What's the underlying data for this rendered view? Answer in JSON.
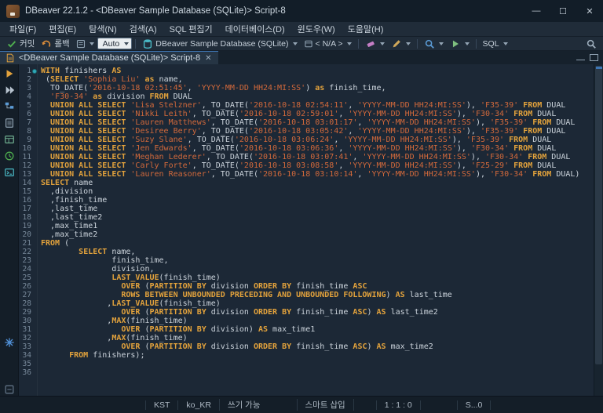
{
  "window": {
    "title": "DBeaver 22.1.2 - <DBeaver Sample Database (SQLite)> Script-8",
    "controls": {
      "minimize": "—",
      "maximize": "☐",
      "close": "✕"
    }
  },
  "menu": {
    "items": [
      "파일(F)",
      "편집(E)",
      "탐색(N)",
      "검색(A)",
      "SQL 편집기",
      "데이터베이스(D)",
      "윈도우(W)",
      "도움말(H)"
    ]
  },
  "toolbar": {
    "commit_label": "커밋",
    "rollback_label": "롤백",
    "tx_mode": "Auto",
    "connection": "DBeaver Sample Database (SQLite)",
    "schema": "< N/A >",
    "sql_label": "SQL"
  },
  "editor_tab": {
    "label": "<DBeaver Sample Database (SQLite)> Script-8",
    "close_glyph": "✕"
  },
  "statusbar": {
    "segments": [
      "KST",
      "ko_KR",
      "쓰기 가능",
      "스마트 삽입",
      "1 : 1 : 0",
      "S...0"
    ]
  },
  "colors": {
    "keyword": "#e2a23c",
    "string": "#d2693b",
    "plain_text": "#ccd4dc",
    "editor_bg": "#1c2836",
    "accent_blue": "#3e76b4",
    "marker_teal": "#2fa8b8"
  },
  "code": {
    "lines": [
      {
        "n": 1,
        "marker": true,
        "segs": [
          [
            "k",
            "WITH"
          ],
          [
            "p",
            " finishers "
          ],
          [
            "k",
            "AS"
          ]
        ]
      },
      {
        "n": 2,
        "segs": [
          [
            "p",
            " ("
          ],
          [
            "k",
            "SELECT"
          ],
          [
            "p",
            " "
          ],
          [
            "s",
            "'Sophia Liu'"
          ],
          [
            "p",
            " "
          ],
          [
            "k",
            "as"
          ],
          [
            "p",
            " name,"
          ]
        ]
      },
      {
        "n": 3,
        "segs": [
          [
            "p",
            "  TO_DATE("
          ],
          [
            "s",
            "'2016-10-18 02:51:45'"
          ],
          [
            "p",
            ", "
          ],
          [
            "s",
            "'YYYY-MM-DD HH24:MI:SS'"
          ],
          [
            "p",
            ") "
          ],
          [
            "k",
            "as"
          ],
          [
            "p",
            " finish_time,"
          ]
        ]
      },
      {
        "n": 4,
        "segs": [
          [
            "p",
            "  "
          ],
          [
            "s",
            "'F30-34'"
          ],
          [
            "p",
            " "
          ],
          [
            "k",
            "as"
          ],
          [
            "p",
            " division "
          ],
          [
            "k",
            "FROM"
          ],
          [
            "p",
            " DUAL"
          ]
        ]
      },
      {
        "n": 5,
        "segs": [
          [
            "p",
            "  "
          ],
          [
            "k",
            "UNION ALL SELECT"
          ],
          [
            "p",
            " "
          ],
          [
            "s",
            "'Lisa Stelzner'"
          ],
          [
            "p",
            ", TO_DATE("
          ],
          [
            "s",
            "'2016-10-18 02:54:11'"
          ],
          [
            "p",
            ", "
          ],
          [
            "s",
            "'YYYY-MM-DD HH24:MI:SS'"
          ],
          [
            "p",
            "), "
          ],
          [
            "s",
            "'F35-39'"
          ],
          [
            "p",
            " "
          ],
          [
            "k",
            "FROM"
          ],
          [
            "p",
            " DUAL"
          ]
        ]
      },
      {
        "n": 6,
        "segs": [
          [
            "p",
            "  "
          ],
          [
            "k",
            "UNION ALL SELECT"
          ],
          [
            "p",
            " "
          ],
          [
            "s",
            "'Nikki Leith'"
          ],
          [
            "p",
            ", TO_DATE("
          ],
          [
            "s",
            "'2016-10-18 02:59:01'"
          ],
          [
            "p",
            ", "
          ],
          [
            "s",
            "'YYYY-MM-DD HH24:MI:SS'"
          ],
          [
            "p",
            "), "
          ],
          [
            "s",
            "'F30-34'"
          ],
          [
            "p",
            " "
          ],
          [
            "k",
            "FROM"
          ],
          [
            "p",
            " DUAL"
          ]
        ]
      },
      {
        "n": 7,
        "segs": [
          [
            "p",
            "  "
          ],
          [
            "k",
            "UNION ALL SELECT"
          ],
          [
            "p",
            " "
          ],
          [
            "s",
            "'Lauren Matthews'"
          ],
          [
            "p",
            ", TO_DATE("
          ],
          [
            "s",
            "'2016-10-18 03:01:17'"
          ],
          [
            "p",
            ", "
          ],
          [
            "s",
            "'YYYY-MM-DD HH24:MI:SS'"
          ],
          [
            "p",
            "), "
          ],
          [
            "s",
            "'F35-39'"
          ],
          [
            "p",
            " "
          ],
          [
            "k",
            "FROM"
          ],
          [
            "p",
            " DUAL"
          ]
        ]
      },
      {
        "n": 8,
        "segs": [
          [
            "p",
            "  "
          ],
          [
            "k",
            "UNION ALL SELECT"
          ],
          [
            "p",
            " "
          ],
          [
            "s",
            "'Desiree Berry'"
          ],
          [
            "p",
            ", TO_DATE("
          ],
          [
            "s",
            "'2016-10-18 03:05:42'"
          ],
          [
            "p",
            ", "
          ],
          [
            "s",
            "'YYYY-MM-DD HH24:MI:SS'"
          ],
          [
            "p",
            "), "
          ],
          [
            "s",
            "'F35-39'"
          ],
          [
            "p",
            " "
          ],
          [
            "k",
            "FROM"
          ],
          [
            "p",
            " DUAL"
          ]
        ]
      },
      {
        "n": 9,
        "segs": [
          [
            "p",
            "  "
          ],
          [
            "k",
            "UNION ALL SELECT"
          ],
          [
            "p",
            " "
          ],
          [
            "s",
            "'Suzy Slane'"
          ],
          [
            "p",
            ", TO_DATE("
          ],
          [
            "s",
            "'2016-10-18 03:06:24'"
          ],
          [
            "p",
            ", "
          ],
          [
            "s",
            "'YYYY-MM-DD HH24:MI:SS'"
          ],
          [
            "p",
            "), "
          ],
          [
            "s",
            "'F35-39'"
          ],
          [
            "p",
            " "
          ],
          [
            "k",
            "FROM"
          ],
          [
            "p",
            " DUAL"
          ]
        ]
      },
      {
        "n": 10,
        "segs": [
          [
            "p",
            "  "
          ],
          [
            "k",
            "UNION ALL SELECT"
          ],
          [
            "p",
            " "
          ],
          [
            "s",
            "'Jen Edwards'"
          ],
          [
            "p",
            ", TO_DATE("
          ],
          [
            "s",
            "'2016-10-18 03:06:36'"
          ],
          [
            "p",
            ", "
          ],
          [
            "s",
            "'YYYY-MM-DD HH24:MI:SS'"
          ],
          [
            "p",
            "), "
          ],
          [
            "s",
            "'F30-34'"
          ],
          [
            "p",
            " "
          ],
          [
            "k",
            "FROM"
          ],
          [
            "p",
            " DUAL"
          ]
        ]
      },
      {
        "n": 11,
        "segs": [
          [
            "p",
            "  "
          ],
          [
            "k",
            "UNION ALL SELECT"
          ],
          [
            "p",
            " "
          ],
          [
            "s",
            "'Meghan Lederer'"
          ],
          [
            "p",
            ", TO_DATE("
          ],
          [
            "s",
            "'2016-10-18 03:07:41'"
          ],
          [
            "p",
            ", "
          ],
          [
            "s",
            "'YYYY-MM-DD HH24:MI:SS'"
          ],
          [
            "p",
            "), "
          ],
          [
            "s",
            "'F30-34'"
          ],
          [
            "p",
            " "
          ],
          [
            "k",
            "FROM"
          ],
          [
            "p",
            " DUAL"
          ]
        ]
      },
      {
        "n": 12,
        "segs": [
          [
            "p",
            "  "
          ],
          [
            "k",
            "UNION ALL SELECT"
          ],
          [
            "p",
            " "
          ],
          [
            "s",
            "'Carly Forte'"
          ],
          [
            "p",
            ", TO_DATE("
          ],
          [
            "s",
            "'2016-10-18 03:08:58'"
          ],
          [
            "p",
            ", "
          ],
          [
            "s",
            "'YYYY-MM-DD HH24:MI:SS'"
          ],
          [
            "p",
            "), "
          ],
          [
            "s",
            "'F25-29'"
          ],
          [
            "p",
            " "
          ],
          [
            "k",
            "FROM"
          ],
          [
            "p",
            " DUAL"
          ]
        ]
      },
      {
        "n": 13,
        "segs": [
          [
            "p",
            "  "
          ],
          [
            "k",
            "UNION ALL SELECT"
          ],
          [
            "p",
            " "
          ],
          [
            "s",
            "'Lauren Reasoner'"
          ],
          [
            "p",
            ", TO_DATE("
          ],
          [
            "s",
            "'2016-10-18 03:10:14'"
          ],
          [
            "p",
            ", "
          ],
          [
            "s",
            "'YYYY-MM-DD HH24:MI:SS'"
          ],
          [
            "p",
            "), "
          ],
          [
            "s",
            "'F30-34'"
          ],
          [
            "p",
            " "
          ],
          [
            "k",
            "FROM"
          ],
          [
            "p",
            " DUAL)"
          ]
        ]
      },
      {
        "n": 14,
        "segs": [
          [
            "k",
            "SELECT"
          ],
          [
            "p",
            " name"
          ]
        ]
      },
      {
        "n": 15,
        "segs": [
          [
            "p",
            "  ,division"
          ]
        ]
      },
      {
        "n": 16,
        "segs": [
          [
            "p",
            "  ,finish_time"
          ]
        ]
      },
      {
        "n": 17,
        "segs": [
          [
            "p",
            "  ,last_time"
          ]
        ]
      },
      {
        "n": 18,
        "segs": [
          [
            "p",
            "  ,last_time2"
          ]
        ]
      },
      {
        "n": 19,
        "segs": [
          [
            "p",
            "  ,max_time1"
          ]
        ]
      },
      {
        "n": 20,
        "segs": [
          [
            "p",
            "  ,max_time2"
          ]
        ]
      },
      {
        "n": 21,
        "segs": [
          [
            "k",
            "FROM"
          ],
          [
            "p",
            " ("
          ]
        ]
      },
      {
        "n": 22,
        "segs": [
          [
            "p",
            "        "
          ],
          [
            "k",
            "SELECT"
          ],
          [
            "p",
            " name,"
          ]
        ]
      },
      {
        "n": 23,
        "segs": [
          [
            "p",
            "               finish_time,"
          ]
        ]
      },
      {
        "n": 24,
        "segs": [
          [
            "p",
            "               division,"
          ]
        ]
      },
      {
        "n": 25,
        "segs": [
          [
            "p",
            "               "
          ],
          [
            "k",
            "LAST_VALUE"
          ],
          [
            "p",
            "(finish_time)"
          ]
        ]
      },
      {
        "n": 26,
        "segs": [
          [
            "p",
            "                 "
          ],
          [
            "k",
            "OVER"
          ],
          [
            "p",
            " ("
          ],
          [
            "k",
            "PARTITION BY"
          ],
          [
            "p",
            " division "
          ],
          [
            "k",
            "ORDER BY"
          ],
          [
            "p",
            " finish_time "
          ],
          [
            "k",
            "ASC"
          ]
        ]
      },
      {
        "n": 27,
        "segs": [
          [
            "p",
            "                 "
          ],
          [
            "k",
            "ROWS BETWEEN UNBOUNDED PRECEDING AND UNBOUNDED FOLLOWING"
          ],
          [
            "p",
            ") "
          ],
          [
            "k",
            "AS"
          ],
          [
            "p",
            " last_time"
          ]
        ]
      },
      {
        "n": 28,
        "segs": [
          [
            "p",
            "              ,"
          ],
          [
            "k",
            "LAST_VALUE"
          ],
          [
            "p",
            "(finish_time)"
          ]
        ]
      },
      {
        "n": 29,
        "segs": [
          [
            "p",
            "                 "
          ],
          [
            "k",
            "OVER"
          ],
          [
            "p",
            " ("
          ],
          [
            "k",
            "PARTITION BY"
          ],
          [
            "p",
            " division "
          ],
          [
            "k",
            "ORDER BY"
          ],
          [
            "p",
            " finish_time "
          ],
          [
            "k",
            "ASC"
          ],
          [
            "p",
            ") "
          ],
          [
            "k",
            "AS"
          ],
          [
            "p",
            " last_time2"
          ]
        ]
      },
      {
        "n": 30,
        "segs": [
          [
            "p",
            "              ,"
          ],
          [
            "k",
            "MAX"
          ],
          [
            "p",
            "(finish_time)"
          ]
        ]
      },
      {
        "n": 31,
        "segs": [
          [
            "p",
            "                 "
          ],
          [
            "k",
            "OVER"
          ],
          [
            "p",
            " ("
          ],
          [
            "k",
            "PARTITION BY"
          ],
          [
            "p",
            " division) "
          ],
          [
            "k",
            "AS"
          ],
          [
            "p",
            " max_time1"
          ]
        ]
      },
      {
        "n": 32,
        "segs": [
          [
            "p",
            "              ,"
          ],
          [
            "k",
            "MAX"
          ],
          [
            "p",
            "(finish_time)"
          ]
        ]
      },
      {
        "n": 33,
        "segs": [
          [
            "p",
            "                 "
          ],
          [
            "k",
            "OVER"
          ],
          [
            "p",
            " ("
          ],
          [
            "k",
            "PARTITION BY"
          ],
          [
            "p",
            " division "
          ],
          [
            "k",
            "ORDER BY"
          ],
          [
            "p",
            " finish_time "
          ],
          [
            "k",
            "ASC"
          ],
          [
            "p",
            ") "
          ],
          [
            "k",
            "AS"
          ],
          [
            "p",
            " max_time2"
          ]
        ]
      },
      {
        "n": 34,
        "segs": [
          [
            "p",
            "      "
          ],
          [
            "k",
            "FROM"
          ],
          [
            "p",
            " finishers);"
          ]
        ]
      },
      {
        "n": 35,
        "segs": []
      },
      {
        "n": 36,
        "segs": []
      }
    ]
  }
}
